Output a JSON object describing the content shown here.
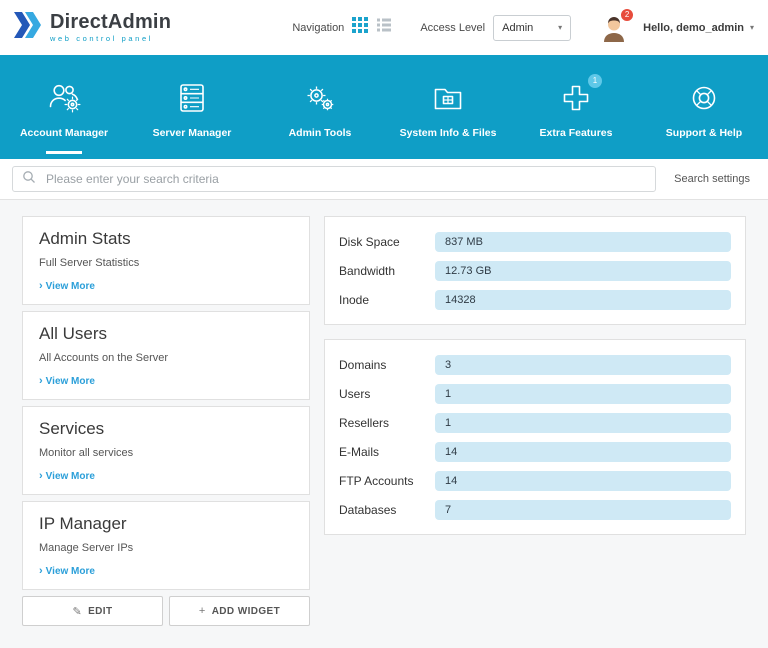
{
  "header": {
    "logo_title": "DirectAdmin",
    "logo_subtitle": "web control panel",
    "navigation_label": "Navigation",
    "access_level_label": "Access Level",
    "access_level_value": "Admin",
    "greeting": "Hello, demo_admin",
    "notification_count": "2"
  },
  "nav": {
    "items": [
      {
        "label": "Account Manager",
        "icon": "account-manager-icon"
      },
      {
        "label": "Server Manager",
        "icon": "server-manager-icon"
      },
      {
        "label": "Admin Tools",
        "icon": "admin-tools-icon"
      },
      {
        "label": "System Info & Files",
        "icon": "system-info-files-icon"
      },
      {
        "label": "Extra Features",
        "icon": "extra-features-icon",
        "badge": "1"
      },
      {
        "label": "Support & Help",
        "icon": "support-help-icon"
      }
    ]
  },
  "search": {
    "placeholder": "Please enter your search criteria",
    "settings_label": "Search settings"
  },
  "widgets": {
    "items": [
      {
        "title": "Admin Stats",
        "description": "Full Server Statistics",
        "link_label": "View More"
      },
      {
        "title": "All Users",
        "description": "All Accounts on the Server",
        "link_label": "View More"
      },
      {
        "title": "Services",
        "description": "Monitor all services",
        "link_label": "View More"
      },
      {
        "title": "IP Manager",
        "description": "Manage Server IPs",
        "link_label": "View More"
      }
    ],
    "edit_label": "EDIT",
    "add_widget_label": "ADD WIDGET"
  },
  "stats": {
    "usage_rows": [
      {
        "label": "Disk Space",
        "value": "837 MB"
      },
      {
        "label": "Bandwidth",
        "value": "12.73 GB"
      },
      {
        "label": "Inode",
        "value": "14328"
      }
    ],
    "count_rows": [
      {
        "label": "Domains",
        "value": "3"
      },
      {
        "label": "Users",
        "value": "1"
      },
      {
        "label": "Resellers",
        "value": "1"
      },
      {
        "label": "E-Mails",
        "value": "14"
      },
      {
        "label": "FTP Accounts",
        "value": "14"
      },
      {
        "label": "Databases",
        "value": "7"
      }
    ]
  },
  "icons": {
    "caret": "▾",
    "pencil": "✎",
    "plus": "+",
    "view_more_arrow": "›"
  },
  "colors": {
    "teal": "#0f9ec6",
    "pill": "#cfe9f5",
    "badge-red": "#e74c3c",
    "link-blue": "#2b9fd9"
  }
}
